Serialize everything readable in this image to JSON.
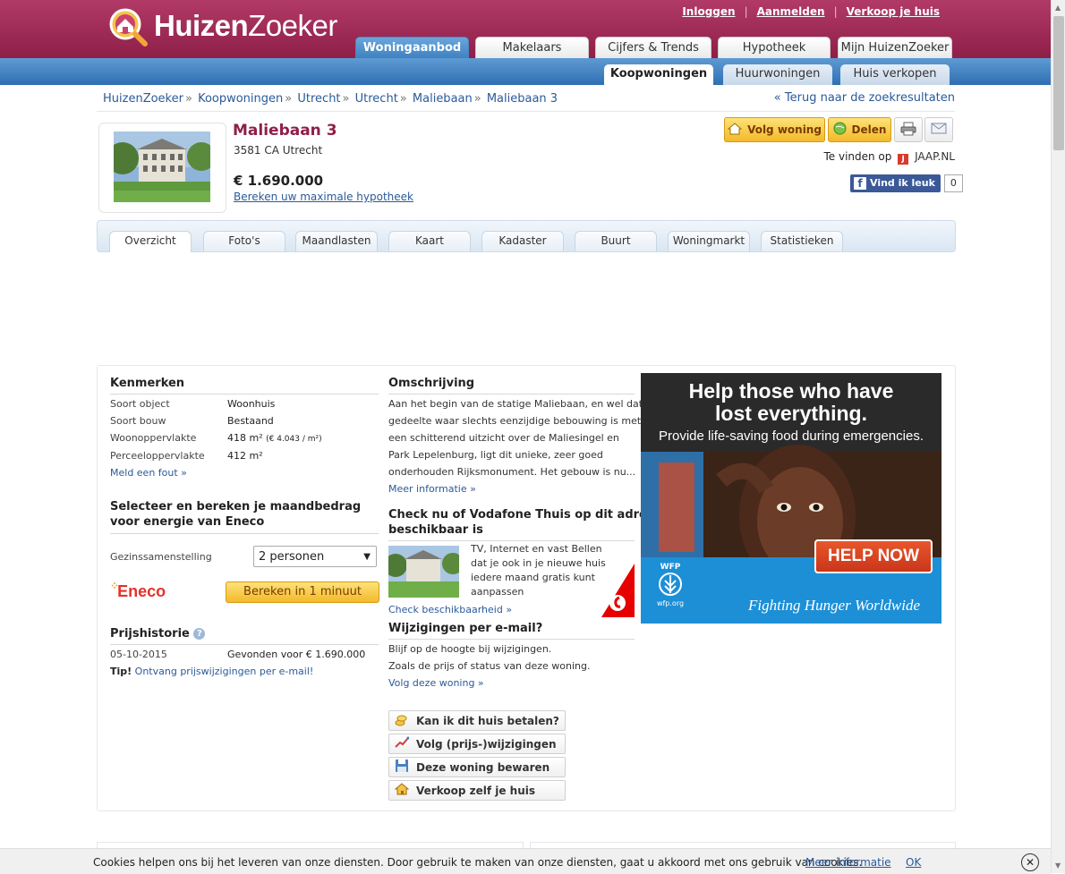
{
  "header": {
    "logo_text_bold": "Huizen",
    "logo_text_light": "Zoeker",
    "top_links": [
      "Inloggen",
      "Aanmelden",
      "Verkoop je huis"
    ],
    "main_tabs": [
      "Woningaanbod",
      "Makelaars",
      "Cijfers & Trends",
      "Hypotheek",
      "Mijn HuizenZoeker"
    ],
    "sub_tabs": [
      "Koopwoningen",
      "Huurwoningen",
      "Huis verkopen"
    ]
  },
  "breadcrumb": [
    "HuizenZoeker",
    "Koopwoningen",
    "Utrecht",
    "Utrecht",
    "Maliebaan",
    "Maliebaan 3"
  ],
  "breadcrumb_sep": "»",
  "back_link": "« Terug naar de zoekresultaten",
  "property": {
    "title": "Maliebaan 3",
    "address": "3581 CA Utrecht",
    "price": "€ 1.690.000",
    "mortgage_link": "Bereken uw maximale hypotheek",
    "follow_button": "Volg woning",
    "share_button": "Delen",
    "found_on_label": "Te vinden op",
    "found_on_site": "JAAP.NL",
    "fb_like": "Vind ik leuk",
    "fb_count": "0"
  },
  "detail_tabs": [
    "Overzicht",
    "Foto's",
    "Maandlasten",
    "Kaart",
    "Kadaster",
    "Buurt",
    "Woningmarkt",
    "Statistieken"
  ],
  "kenmerken": {
    "title": "Kenmerken",
    "rows": [
      {
        "label": "Soort object",
        "value": "Woonhuis"
      },
      {
        "label": "Soort bouw",
        "value": "Bestaand"
      },
      {
        "label": "Woonoppervlakte",
        "value": "418 m²",
        "extra": "(€ 4.043 / m²)"
      },
      {
        "label": "Perceeloppervlakte",
        "value": "412 m²"
      }
    ],
    "error_link": "Meld een fout »"
  },
  "energy": {
    "title_line1": "Selecteer en bereken je maandbedrag",
    "title_line2": "voor energie van Eneco",
    "household_label": "Gezinssamenstelling",
    "household_value": "2 personen",
    "brand": "Eneco",
    "calc_button": "Bereken in 1 minuut"
  },
  "price_history": {
    "title": "Prijshistorie",
    "date": "05-10-2015",
    "event": "Gevonden voor € 1.690.000",
    "tip_label": "Tip!",
    "tip_link": "Ontvang prijswijzigingen per e-mail!"
  },
  "description": {
    "title": "Omschrijving",
    "lines": [
      "Aan het begin van de statige Maliebaan, en wel dat",
      "gedeelte waar slechts eenzijdige bebouwing is met",
      "een schitterend uitzicht over de Maliesingel en",
      "Park Lepelenburg, ligt dit unieke, zeer goed",
      "onderhouden Rijksmonument. Het gebouw is nu..."
    ],
    "more_link": "Meer informatie »"
  },
  "vodafone": {
    "title_line1": "Check nu of Vodafone Thuis op dit adres",
    "title_line2": "beschikbaar is",
    "lines": [
      "TV, Internet en vast Bellen",
      "dat je ook in je nieuwe huis",
      "iedere maand gratis kunt",
      "aanpassen"
    ],
    "link": "Check beschikbaarheid »"
  },
  "email_changes": {
    "title": "Wijzigingen per e-mail?",
    "line1": "Blijf op de hoogte bij wijzigingen.",
    "line2": "Zoals de prijs of status van deze woning.",
    "link": "Volg deze woning »"
  },
  "actions": [
    "Kan ik dit huis betalen?",
    "Volg (prijs-)wijzigingen",
    "Deze woning bewaren",
    "Verkoop zelf je huis"
  ],
  "ad": {
    "headline_line1": "Help those who have",
    "headline_line2": "lost everything.",
    "sub": "Provide life-saving food during emergencies.",
    "cta": "HELP NOW",
    "org_short": "WFP",
    "org_url": "wfp.org",
    "tagline": "Fighting Hunger Worldwide"
  },
  "cookie": {
    "text": "Cookies helpen ons bij het leveren van onze diensten. Door gebruik te maken van onze diensten, gaat u akkoord met ons gebruik van cookies.",
    "more": "Meer informatie",
    "ok": "OK",
    "close": "✕"
  },
  "colors": {
    "brand": "#9a2651",
    "nav_blue": "#3d7fc0",
    "button_yellow": "#f7c63d",
    "link": "#2a5a9a"
  }
}
